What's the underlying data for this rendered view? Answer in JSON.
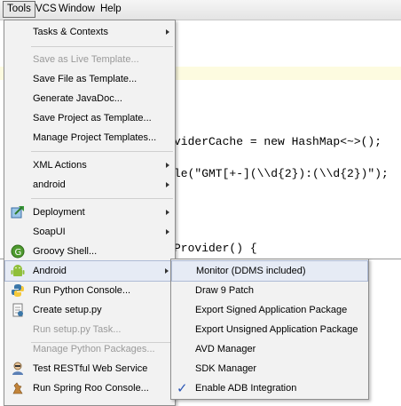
{
  "menubar": {
    "items": [
      {
        "label": "Tools"
      },
      {
        "label": "VCS"
      },
      {
        "label": "Window"
      },
      {
        "label": "Help"
      }
    ]
  },
  "editor": {
    "line1": "viderCache = new HashMap<~>();",
    "line2": "le(\"GMT[+-](\\\\d{2}):(\\\\d{2})\");",
    "line3": "Provider() {"
  },
  "tools_menu": {
    "items": [
      {
        "label": "Tasks & Contexts"
      },
      {
        "label": "Save as Live Template..."
      },
      {
        "label": "Save File as Template..."
      },
      {
        "label": "Generate JavaDoc..."
      },
      {
        "label": "Save Project as Template..."
      },
      {
        "label": "Manage Project Templates..."
      },
      {
        "label": "XML Actions"
      },
      {
        "label": "android"
      },
      {
        "label": "Deployment"
      },
      {
        "label": "SoapUI"
      },
      {
        "label": "Groovy Shell..."
      },
      {
        "label": "Android"
      },
      {
        "label": "Run Python Console..."
      },
      {
        "label": "Create setup.py"
      },
      {
        "label": "Run setup.py Task..."
      },
      {
        "label": "Manage Python Packages..."
      },
      {
        "label": "Test RESTful Web Service"
      },
      {
        "label": "Run Spring Roo Console..."
      }
    ]
  },
  "android_submenu": {
    "items": [
      {
        "label": "Monitor (DDMS included)"
      },
      {
        "label": "Draw 9 Patch"
      },
      {
        "label": "Export Signed Application Package"
      },
      {
        "label": "Export Unsigned Application Package"
      },
      {
        "label": "AVD Manager"
      },
      {
        "label": "SDK Manager"
      },
      {
        "label": "Enable ADB Integration"
      }
    ]
  }
}
